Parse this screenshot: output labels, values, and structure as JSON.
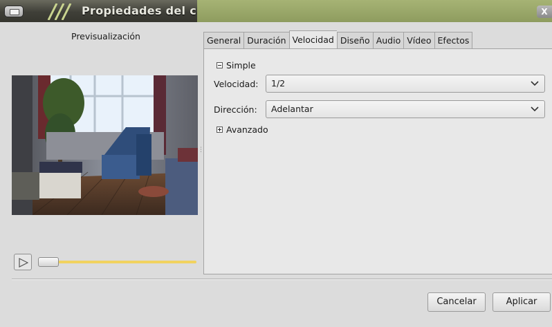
{
  "window": {
    "title": "Propiedades del clip",
    "close_glyph": "X"
  },
  "preview": {
    "label": "Previsualización"
  },
  "tabs": [
    {
      "label": "General"
    },
    {
      "label": "Duración"
    },
    {
      "label": "Velocidad",
      "active": true
    },
    {
      "label": "Diseño"
    },
    {
      "label": "Audio"
    },
    {
      "label": "Vídeo"
    },
    {
      "label": "Efectos"
    }
  ],
  "speed": {
    "simple_label": "Simple",
    "velocity_label": "Velocidad:",
    "velocity_value": "1/2",
    "direction_label": "Dirección:",
    "direction_value": "Adelantar",
    "advanced_label": "Avanzado"
  },
  "buttons": {
    "cancel": "Cancelar",
    "apply": "Aplicar"
  },
  "colors": {
    "accent_slider": "#f1d25f",
    "titlebar_green": "#9aa86a"
  }
}
